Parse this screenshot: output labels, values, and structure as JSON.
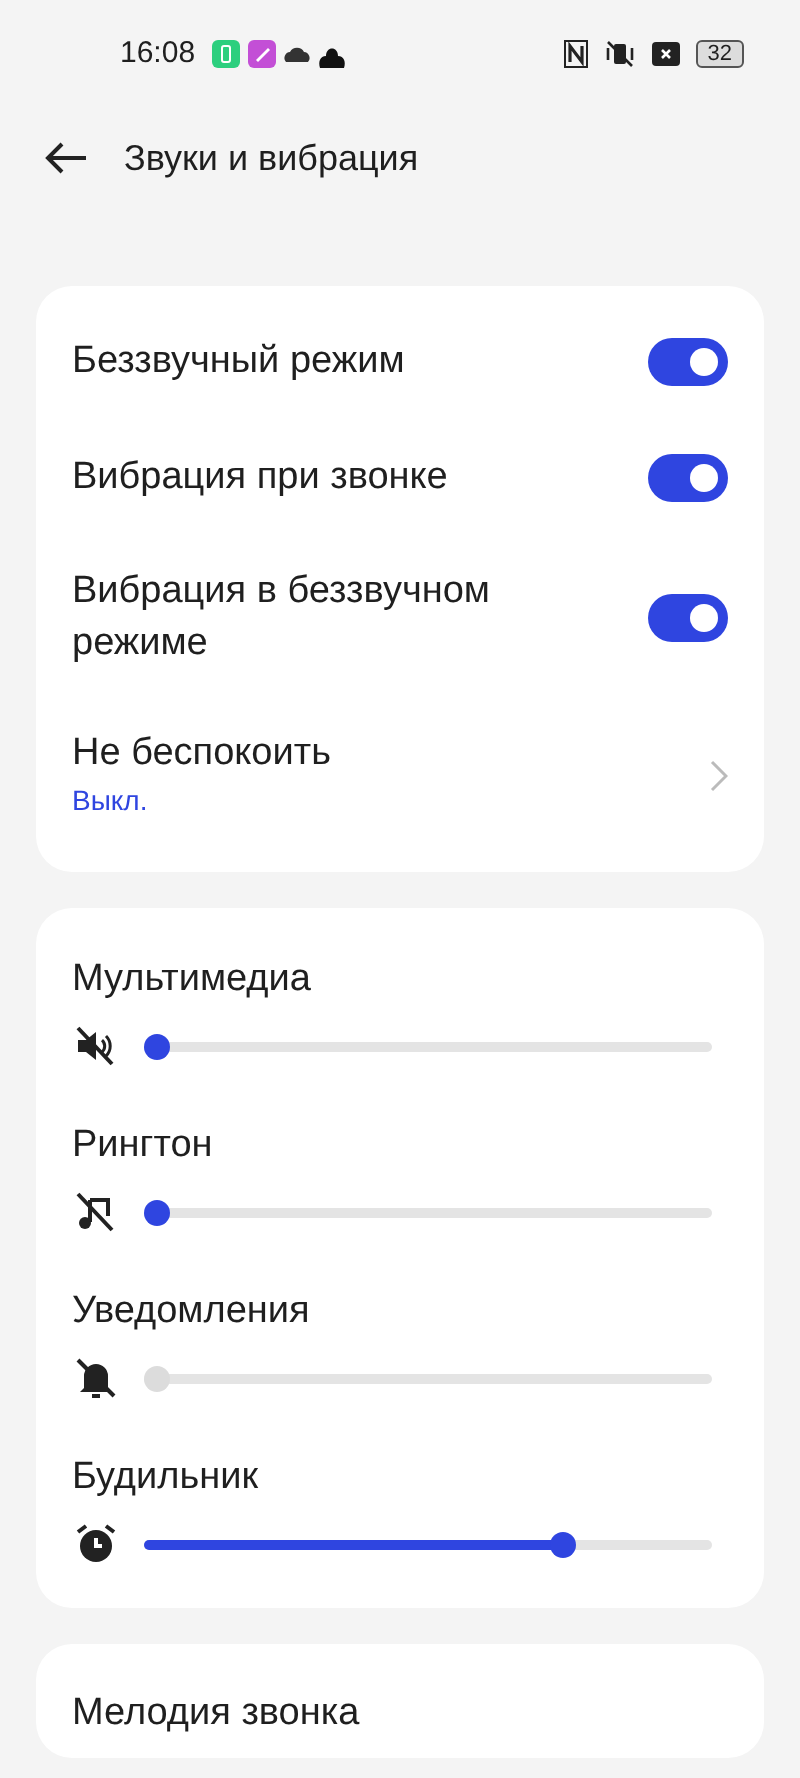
{
  "status_bar": {
    "time": "16:08",
    "battery": "32"
  },
  "header": {
    "title": "Звуки и вибрация"
  },
  "toggles": [
    {
      "label": "Беззвучный режим",
      "on": true
    },
    {
      "label": "Вибрация при звонке",
      "on": true
    },
    {
      "label": "Вибрация в беззвучном режиме",
      "on": true
    }
  ],
  "do_not_disturb": {
    "label": "Не беспокоить",
    "value": "Выкл."
  },
  "volumes": [
    {
      "label": "Мультимедиа",
      "kind": "media",
      "level": 0,
      "disabled": false
    },
    {
      "label": "Рингтон",
      "kind": "ringtone",
      "level": 0,
      "disabled": false
    },
    {
      "label": "Уведомления",
      "kind": "notification",
      "level": 0,
      "disabled": true
    },
    {
      "label": "Будильник",
      "kind": "alarm",
      "level": 0.75,
      "disabled": false
    }
  ],
  "ringtone": {
    "label": "Мелодия звонка"
  }
}
